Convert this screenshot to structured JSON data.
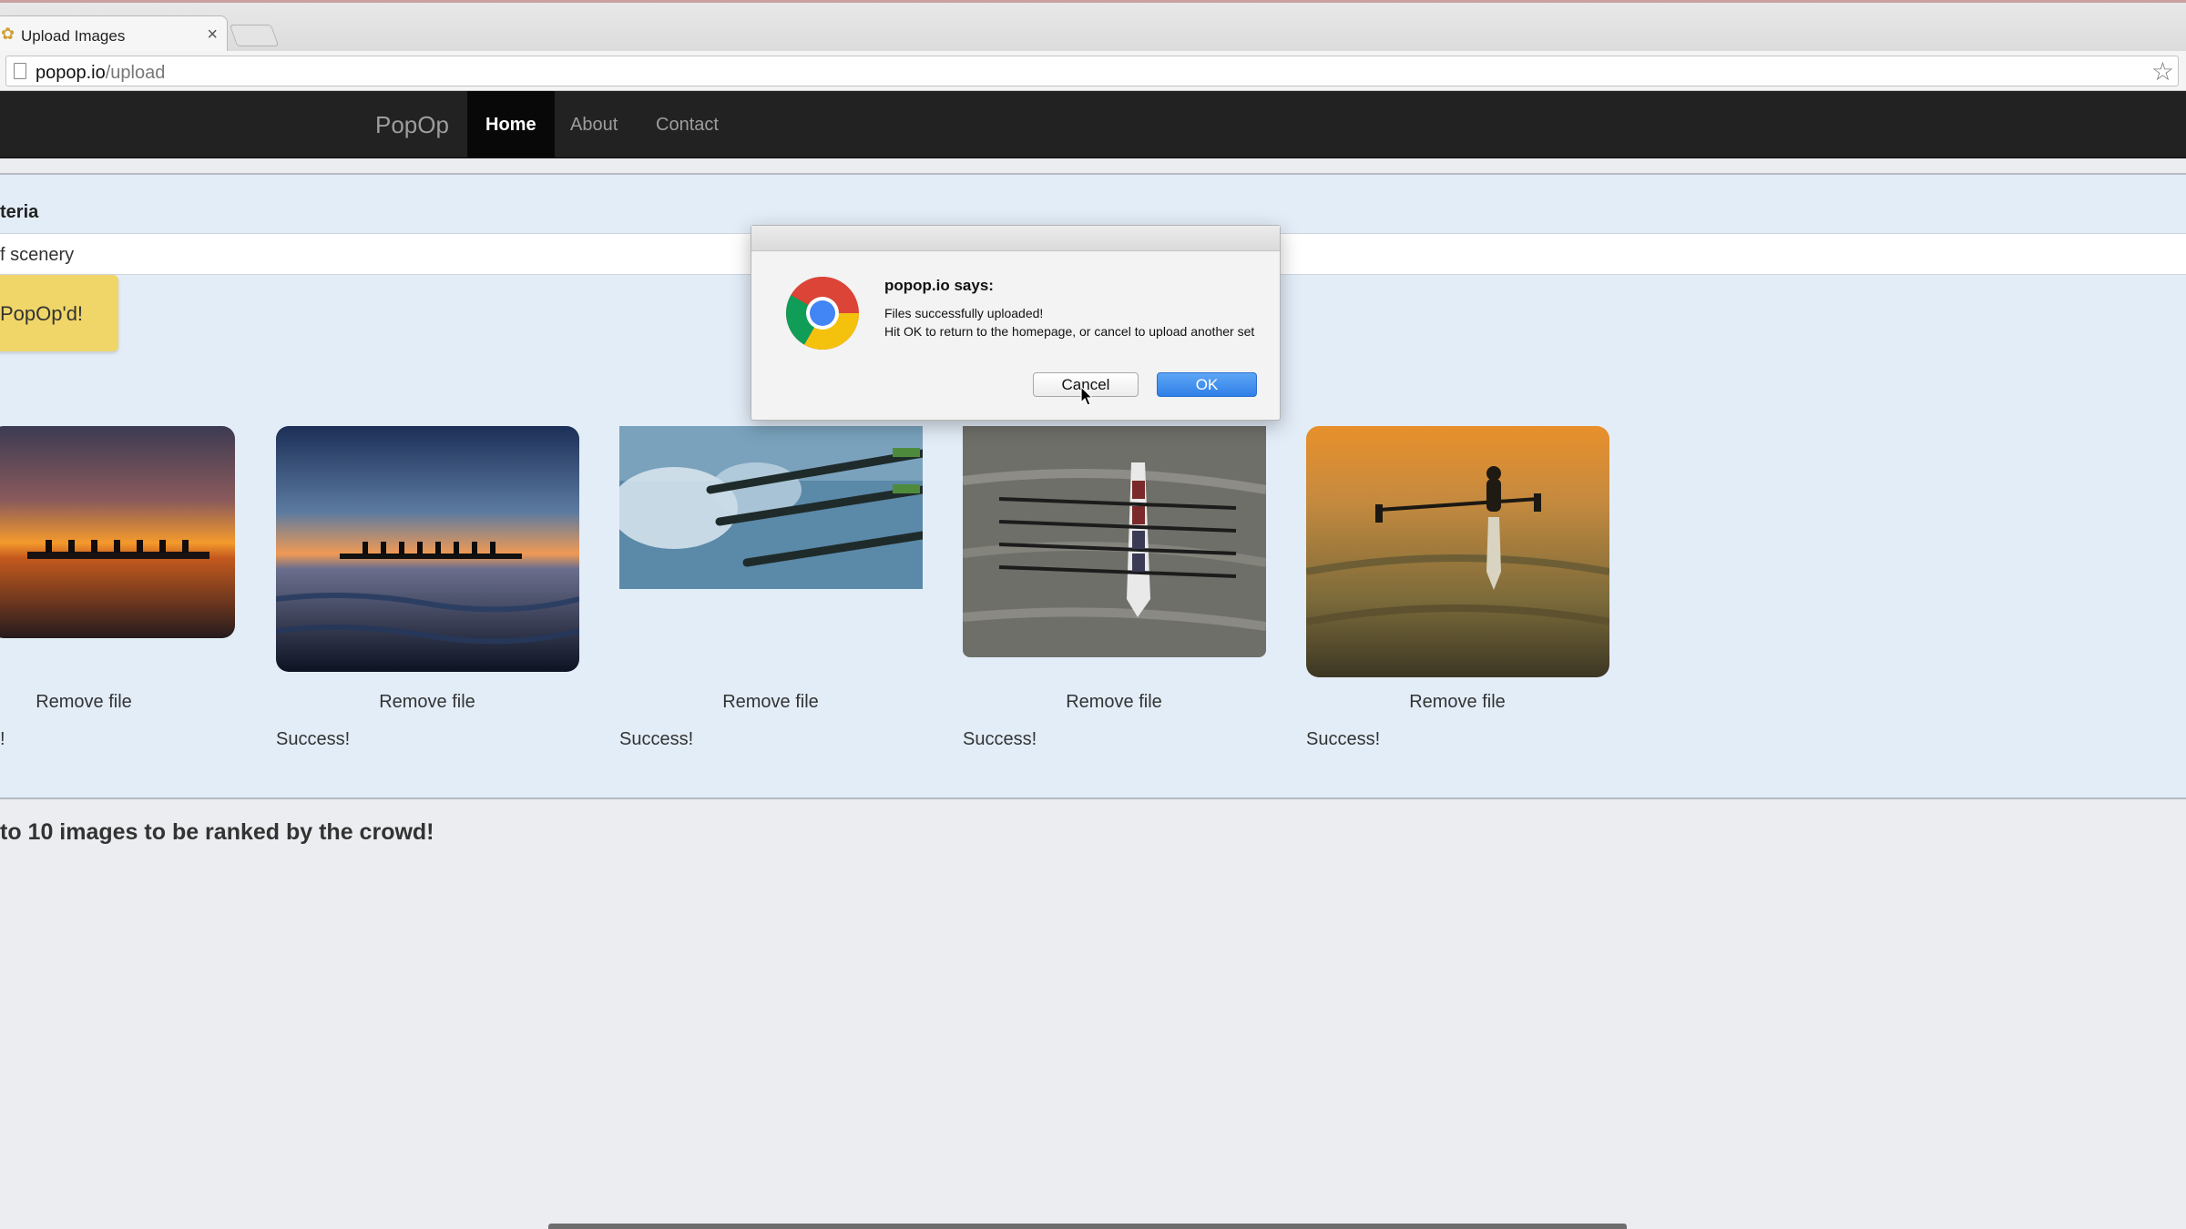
{
  "browser": {
    "tab_title": "Upload Images",
    "tab_close": "×",
    "url_host": "popop.io",
    "url_path": "/upload"
  },
  "navbar": {
    "brand": "PopOp",
    "items": [
      {
        "label": "Home",
        "active": true
      },
      {
        "label": "About",
        "active": false
      },
      {
        "label": "Contact",
        "active": false
      }
    ]
  },
  "upload": {
    "criteria_label": "teria",
    "criteria_value": "f scenery",
    "submit_label": "PopOp'd!",
    "files": [
      {
        "remove_label": "Remove file",
        "status": "!"
      },
      {
        "remove_label": "Remove file",
        "status": "Success!"
      },
      {
        "remove_label": "Remove file",
        "status": "Success!"
      },
      {
        "remove_label": "Remove file",
        "status": "Success!"
      },
      {
        "remove_label": "Remove file",
        "status": "Success!"
      }
    ],
    "footer_text": "to 10 images to be ranked by the crowd!"
  },
  "dialog": {
    "heading": "popop.io says:",
    "message_line1": "Files successfully uploaded!",
    "message_line2": "Hit OK to return to the homepage, or cancel to upload another set",
    "cancel_label": "Cancel",
    "ok_label": "OK"
  },
  "colors": {
    "navbar_bg": "#222222",
    "panel_bg": "#e3edf8",
    "submit_bg": "#f0d668",
    "ok_button": "#2f7fe8"
  }
}
